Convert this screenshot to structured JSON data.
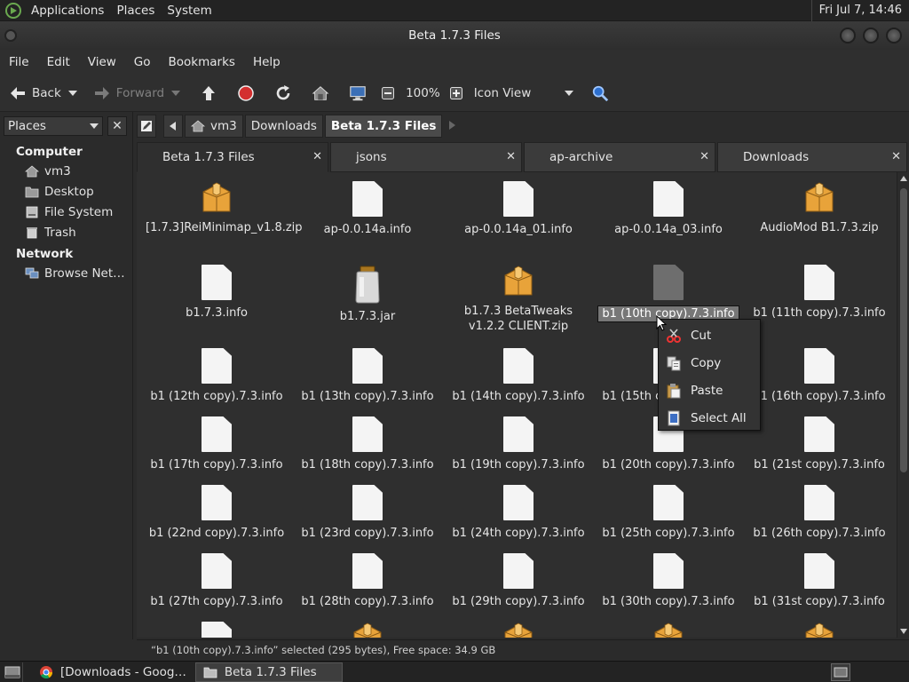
{
  "top_panel": {
    "menus": [
      "Applications",
      "Places",
      "System"
    ],
    "clock": "Fri Jul  7, 14:46"
  },
  "window": {
    "title": "Beta 1.7.3 Files"
  },
  "menubar": [
    "File",
    "Edit",
    "View",
    "Go",
    "Bookmarks",
    "Help"
  ],
  "toolbar": {
    "back": "Back",
    "forward": "Forward",
    "zoom": "100%",
    "view_mode": "Icon View"
  },
  "sidepane": {
    "selector": "Places",
    "computer_header": "Computer",
    "computer_items": [
      "vm3",
      "Desktop",
      "File System",
      "Trash"
    ],
    "network_header": "Network",
    "network_items": [
      "Browse Net…"
    ]
  },
  "location": {
    "crumbs": [
      "vm3",
      "Downloads",
      "Beta 1.7.3 Files"
    ]
  },
  "tabs": [
    "Beta 1.7.3 Files",
    "jsons",
    "ap-archive",
    "Downloads"
  ],
  "files": [
    {
      "name": "[1.7.3]ReiMinimap_v1.8.zip",
      "kind": "package"
    },
    {
      "name": "ap-0.0.14a.info",
      "kind": "document"
    },
    {
      "name": "ap-0.0.14a_01.info",
      "kind": "document"
    },
    {
      "name": "ap-0.0.14a_03.info",
      "kind": "document"
    },
    {
      "name": "AudioMod B1.7.3.zip",
      "kind": "package"
    },
    {
      "name": "b1.7.3.info",
      "kind": "document"
    },
    {
      "name": "b1.7.3.jar",
      "kind": "jar"
    },
    {
      "name": "b1.7.3 BetaTweaks v1.2.2 CLIENT.zip",
      "kind": "package"
    },
    {
      "name": "b1 (10th copy).7.3.info",
      "kind": "document",
      "selected": true
    },
    {
      "name": "b1 (11th copy).7.3.info",
      "kind": "document"
    },
    {
      "name": "b1 (12th copy).7.3.info",
      "kind": "document"
    },
    {
      "name": "b1 (13th copy).7.3.info",
      "kind": "document"
    },
    {
      "name": "b1 (14th copy).7.3.info",
      "kind": "document"
    },
    {
      "name": "b1 (15th copy).7.3.info",
      "kind": "document"
    },
    {
      "name": "b1 (16th copy).7.3.info",
      "kind": "document"
    },
    {
      "name": "b1 (17th copy).7.3.info",
      "kind": "document"
    },
    {
      "name": "b1 (18th copy).7.3.info",
      "kind": "document"
    },
    {
      "name": "b1 (19th copy).7.3.info",
      "kind": "document"
    },
    {
      "name": "b1 (20th copy).7.3.info",
      "kind": "document"
    },
    {
      "name": "b1 (21st copy).7.3.info",
      "kind": "document"
    },
    {
      "name": "b1 (22nd copy).7.3.info",
      "kind": "document"
    },
    {
      "name": "b1 (23rd copy).7.3.info",
      "kind": "document"
    },
    {
      "name": "b1 (24th copy).7.3.info",
      "kind": "document"
    },
    {
      "name": "b1 (25th copy).7.3.info",
      "kind": "document"
    },
    {
      "name": "b1 (26th copy).7.3.info",
      "kind": "document"
    },
    {
      "name": "b1 (27th copy).7.3.info",
      "kind": "document"
    },
    {
      "name": "b1 (28th copy).7.3.info",
      "kind": "document"
    },
    {
      "name": "b1 (29th copy).7.3.info",
      "kind": "document"
    },
    {
      "name": "b1 (30th copy).7.3.info",
      "kind": "document"
    },
    {
      "name": "b1 (31st copy).7.3.info",
      "kind": "document"
    }
  ],
  "partial_next_row_kinds": [
    "document",
    "package",
    "package",
    "package",
    "package"
  ],
  "context_menu": {
    "items": [
      {
        "label": "Cut",
        "icon": "scissors-icon"
      },
      {
        "label": "Copy",
        "icon": "copy-icon"
      },
      {
        "label": "Paste",
        "icon": "paste-icon"
      },
      {
        "label": "Select All",
        "icon": "select-all-icon"
      }
    ]
  },
  "status": "“b1 (10th copy).7.3.info” selected (295 bytes), Free space: 34.9 GB",
  "taskbar": {
    "tasks": [
      "[Downloads - Goog…",
      "Beta 1.7.3 Files"
    ]
  },
  "colors": {
    "accent_green": "#6aa84f",
    "package_orange": "#e8a33a",
    "stop_red": "#d32f2f",
    "selection_gray": "#777777"
  }
}
